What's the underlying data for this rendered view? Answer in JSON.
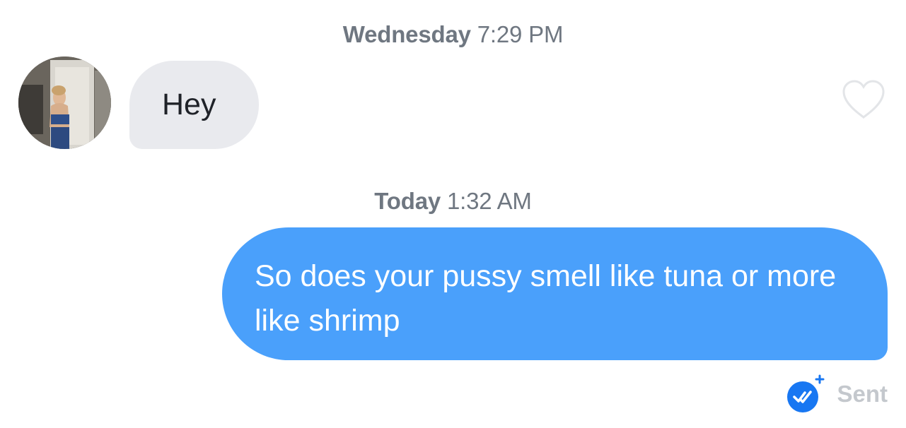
{
  "conversation": {
    "messages": [
      {
        "timestamp_day": "Wednesday",
        "timestamp_time": "7:29 PM",
        "direction": "incoming",
        "text": "Hey",
        "liked": false
      },
      {
        "timestamp_day": "Today",
        "timestamp_time": "1:32 AM",
        "direction": "outgoing",
        "text": "So does your pussy smell like tuna or more like shrimp",
        "status": "Sent"
      }
    ]
  },
  "icons": {
    "like": "heart-outline-icon",
    "read_receipt": "double-check-badge-icon"
  },
  "colors": {
    "outgoing_bubble": "#4aa0fb",
    "incoming_bubble": "#e9eaee",
    "timestamp": "#6f7781",
    "status_text": "#c4c8cd",
    "receipt_badge": "#1877f2"
  }
}
